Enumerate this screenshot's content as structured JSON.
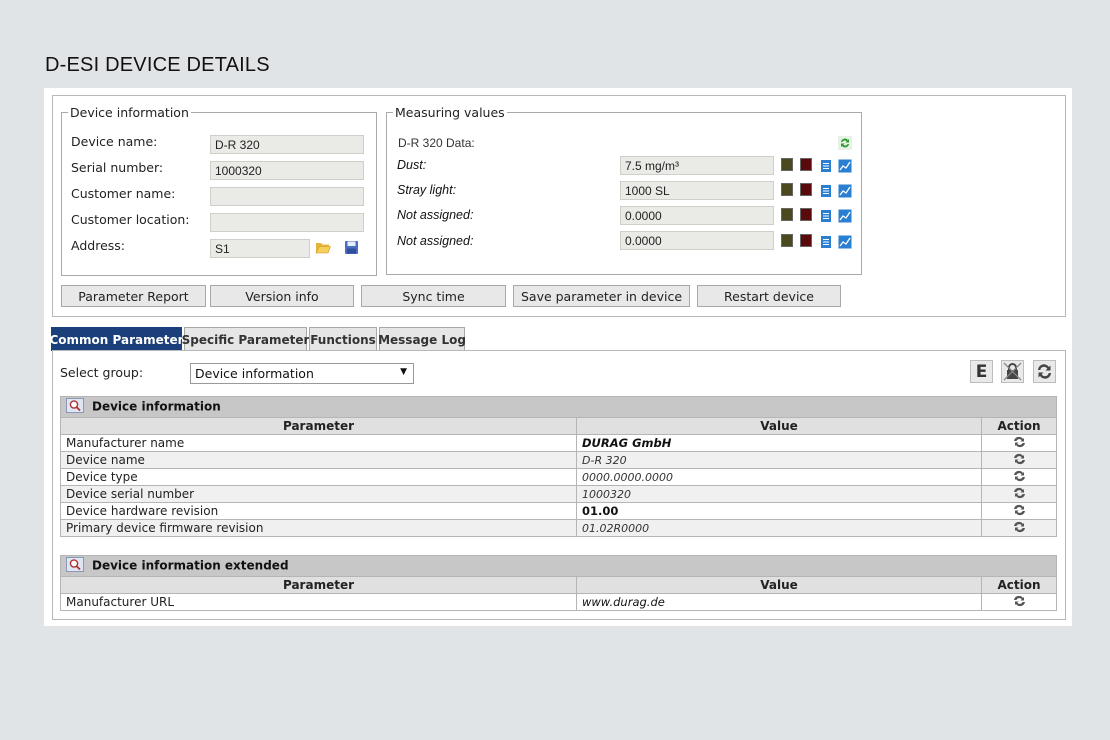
{
  "page": {
    "title": "D-ESI DEVICE DETAILS"
  },
  "device_info": {
    "legend": "Device information",
    "fields": [
      {
        "label": "Device name:",
        "value": "D-R 320"
      },
      {
        "label": "Serial number:",
        "value": "1000320"
      },
      {
        "label": "Customer name:",
        "value": ""
      },
      {
        "label": "Customer location:",
        "value": ""
      },
      {
        "label": "Address:",
        "value": "S1"
      }
    ]
  },
  "measuring": {
    "legend": "Measuring values",
    "data_label": "D-R 320 Data:",
    "rows": [
      {
        "label": "Dust:",
        "value": "7.5 mg/m³"
      },
      {
        "label": "Stray light:",
        "value": "1000 SL"
      },
      {
        "label": "Not assigned:",
        "value": "0.0000"
      },
      {
        "label": "Not assigned:",
        "value": "0.0000"
      }
    ]
  },
  "buttons": {
    "parameter_report": "Parameter Report",
    "version_info": "Version info",
    "sync_time": "Sync time",
    "save_parameter": "Save parameter in device",
    "restart_device": "Restart device"
  },
  "tabs": [
    "Common Parameter",
    "Specific Parameter",
    "Functions",
    "Message Log"
  ],
  "group_select": {
    "label": "Select group:",
    "value": "Device information"
  },
  "table_headers": {
    "parameter": "Parameter",
    "value": "Value",
    "action": "Action"
  },
  "groups": [
    {
      "title": "Device information",
      "rows": [
        {
          "parameter": "Manufacturer name",
          "value": "DURAG GmbH"
        },
        {
          "parameter": "Device name",
          "value": "D-R 320"
        },
        {
          "parameter": "Device type",
          "value": "0000.0000.0000"
        },
        {
          "parameter": "Device serial number",
          "value": "1000320"
        },
        {
          "parameter": "Device hardware revision",
          "value": "01.00"
        },
        {
          "parameter": "Primary device firmware revision",
          "value": "01.02R0000"
        }
      ]
    },
    {
      "title": "Device information extended",
      "rows": [
        {
          "parameter": "Manufacturer URL",
          "value": "www.durag.de"
        }
      ]
    }
  ],
  "colors": {
    "active_tab": "#1a3f7a",
    "olive": "#4a4a1e",
    "maroon": "#5a0a0a",
    "accent_blue": "#2a7fd0"
  },
  "tools": {
    "export_letter": "E"
  }
}
